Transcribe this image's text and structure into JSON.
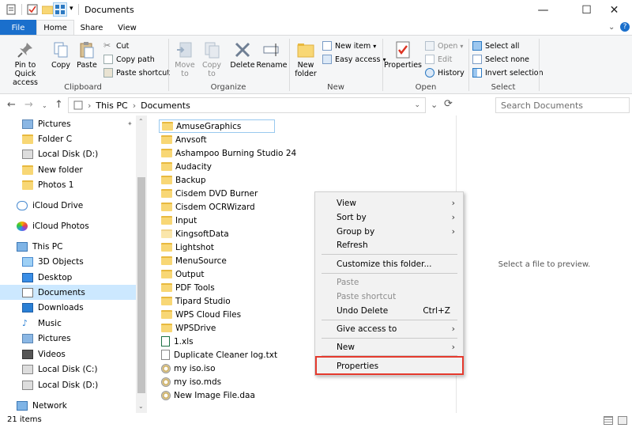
{
  "window": {
    "title": "Documents",
    "minimize": "—",
    "maximize": "☐",
    "close": "✕"
  },
  "tabs": {
    "file": "File",
    "home": "Home",
    "share": "Share",
    "view": "View"
  },
  "ribbon": {
    "clipboard": {
      "pin": "Pin to Quick\naccess",
      "copy": "Copy",
      "paste": "Paste",
      "cut": "Cut",
      "copy_path": "Copy path",
      "paste_shortcut": "Paste shortcut",
      "group": "Clipboard"
    },
    "organize": {
      "move_to": "Move\nto",
      "copy_to": "Copy\nto",
      "delete": "Delete",
      "rename": "Rename",
      "group": "Organize"
    },
    "new": {
      "new_folder": "New\nfolder",
      "new_item": "New item",
      "easy_access": "Easy access",
      "group": "New"
    },
    "open": {
      "properties": "Properties",
      "open": "Open",
      "edit": "Edit",
      "history": "History",
      "group": "Open"
    },
    "select": {
      "select_all": "Select all",
      "select_none": "Select none",
      "invert": "Invert selection",
      "group": "Select"
    }
  },
  "address": {
    "crumbs": [
      "This PC",
      "Documents"
    ],
    "search_placeholder": "Search Documents"
  },
  "nav_items": [
    {
      "label": "Pictures",
      "pin": "📌"
    },
    {
      "label": "Folder C"
    },
    {
      "label": "Local Disk (D:)"
    },
    {
      "label": "New folder"
    },
    {
      "label": "Photos 1"
    },
    {
      "label": "iCloud Drive"
    },
    {
      "label": "iCloud Photos"
    },
    {
      "label": "This PC"
    },
    {
      "label": "3D Objects"
    },
    {
      "label": "Desktop"
    },
    {
      "label": "Documents"
    },
    {
      "label": "Downloads"
    },
    {
      "label": "Music"
    },
    {
      "label": "Pictures"
    },
    {
      "label": "Videos"
    },
    {
      "label": "Local Disk (C:)"
    },
    {
      "label": "Local Disk (D:)"
    },
    {
      "label": "Network"
    }
  ],
  "files": [
    {
      "name": "AmuseGraphics",
      "type": "folder"
    },
    {
      "name": "Anvsoft",
      "type": "folder"
    },
    {
      "name": "Ashampoo Burning Studio 24",
      "type": "folder"
    },
    {
      "name": "Audacity",
      "type": "folder"
    },
    {
      "name": "Backup",
      "type": "folder"
    },
    {
      "name": "Cisdem DVD Burner",
      "type": "folder"
    },
    {
      "name": "Cisdem OCRWizard",
      "type": "folder"
    },
    {
      "name": "Input",
      "type": "folder"
    },
    {
      "name": "KingsoftData",
      "type": "folder"
    },
    {
      "name": "Lightshot",
      "type": "folder"
    },
    {
      "name": "MenuSource",
      "type": "folder"
    },
    {
      "name": "Output",
      "type": "folder"
    },
    {
      "name": "PDF Tools",
      "type": "folder"
    },
    {
      "name": "Tipard Studio",
      "type": "folder"
    },
    {
      "name": "WPS Cloud Files",
      "type": "folder"
    },
    {
      "name": "WPSDrive",
      "type": "folder"
    },
    {
      "name": "1.xls",
      "type": "file"
    },
    {
      "name": "Duplicate Cleaner log.txt",
      "type": "file"
    },
    {
      "name": "my iso.iso",
      "type": "disc"
    },
    {
      "name": "my iso.mds",
      "type": "disc"
    },
    {
      "name": "New Image File.daa",
      "type": "disc"
    }
  ],
  "preview_text": "Select a file to preview.",
  "context_menu": {
    "view": "View",
    "sort_by": "Sort by",
    "group_by": "Group by",
    "refresh": "Refresh",
    "customize": "Customize this folder...",
    "paste": "Paste",
    "paste_shortcut": "Paste shortcut",
    "undo_delete": "Undo Delete",
    "undo_shortcut": "Ctrl+Z",
    "give_access": "Give access to",
    "new": "New",
    "properties": "Properties"
  },
  "status": {
    "items": "21 items"
  },
  "colors": {
    "accent": "#1a6fcc",
    "selection": "#cce8ff",
    "highlight": "#e53a2e"
  }
}
